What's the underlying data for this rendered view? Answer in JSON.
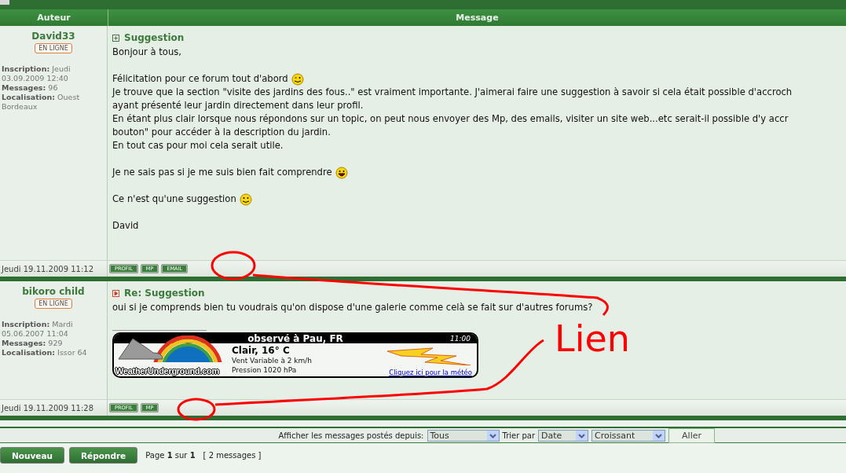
{
  "table": {
    "columns": [
      "Auteur",
      "Message"
    ]
  },
  "posts": [
    {
      "author": "David33",
      "status": "EN LIGNE",
      "profile": [
        "**Inscription:** Jeudi 03.09.2009 12:40",
        "**Messages:** 96",
        "**Localisation:** Ouest Bordeaux"
      ],
      "title": "Suggestion",
      "unread": false,
      "paragraphs": [
        [
          {
            "text": "Bonjour à tous,"
          }
        ],
        [
          {
            "text": "Félicitation pour ce forum tout d'abord",
            "kind": "wink"
          },
          {
            "text": "Je trouve que la section \"visite des jardins des fous..\" est vraiment importante. J'aimerai faire une suggestion à savoir si cela était possible d'accroch"
          },
          {
            "text": "ayant présenté leur jardin directement dans leur profil."
          },
          {
            "text": "En étant plus clair lorsque nous répondons sur un topic, on peut nous envoyer des Mp, des emails, visiter un site web...etc serait-il possible d'y accr"
          },
          {
            "text": "bouton\" pour accéder à la description du jardin."
          },
          {
            "text": "En tout cas pour moi cela serait utile."
          }
        ],
        [
          {
            "text": "Je ne sais pas si je me suis bien fait comprendre",
            "kind": "laugh"
          }
        ],
        [
          {
            "text": "Ce n'est qu'une suggestion",
            "kind": "smile"
          }
        ],
        [
          {
            "text": "David"
          }
        ]
      ],
      "date": "Jeudi 19.11.2009 11:12",
      "buttons": [
        "PROFIL",
        "MP",
        "EMAIL"
      ]
    },
    {
      "author": "bikoro child",
      "status": "EN LIGNE",
      "profile": [
        "**Inscription:** Mardi 05.06.2007 11:04",
        "**Messages:** 929",
        "**Localisation:** Issor 64"
      ],
      "title": "Re: Suggestion",
      "unread": true,
      "paragraphs": [
        [
          {
            "text": "oui si je comprends bien tu voudrais qu'on dispose d'une galerie comme celà se fait sur d'autres forums?"
          }
        ]
      ],
      "signature": {
        "logo": "WeatherUnderground.com",
        "heading": "observé à Pau, FR",
        "time": "11:00",
        "condition": "Clair, 16° C",
        "wind": "Vent Variable à  2 km/h",
        "pressure": "Pression 1020 hPa",
        "link": "Cliquez ici pour la météo"
      },
      "date": "Jeudi 19.11.2009 11:28",
      "buttons": [
        "PROFIL",
        "MP"
      ]
    }
  ],
  "filter": {
    "label": "Afficher les messages postés depuis:",
    "since": "Tous",
    "sort_label": "Trier par",
    "sort_by": "Date",
    "order": "Croissant",
    "submit": "Aller"
  },
  "actions": [
    "Nouveau",
    "Répondre"
  ],
  "pagination": {
    "pages": "Page **1** sur **1**",
    "count": "[ 2 messages ]"
  },
  "annotation": {
    "text": "Lien"
  }
}
